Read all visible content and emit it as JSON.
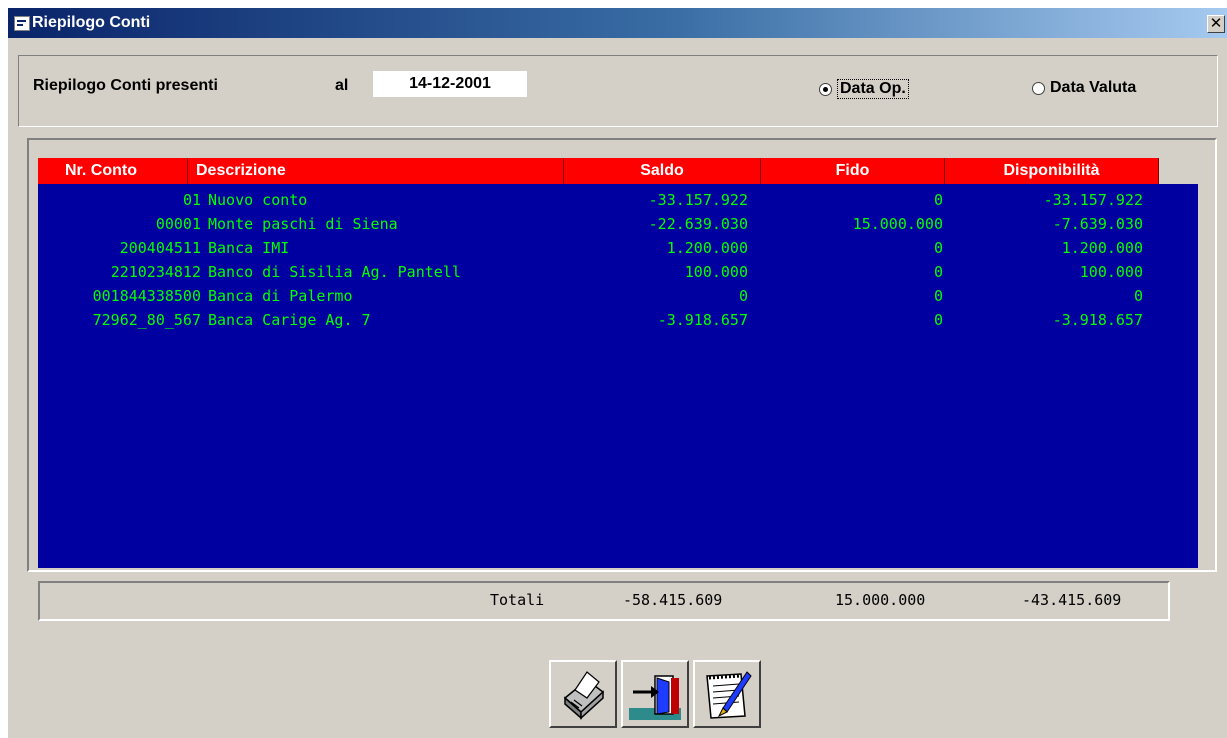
{
  "window": {
    "title": "Riepilogo Conti",
    "close_label": "✕"
  },
  "header": {
    "label": "Riepilogo Conti presenti",
    "al_label": "al",
    "date_value": "14-12-2001",
    "radio_data_op": "Data Op.",
    "radio_data_valuta": "Data Valuta",
    "selected_radio": "Data Op."
  },
  "grid": {
    "columns": [
      "Nr. Conto",
      "Descrizione",
      "Saldo",
      "Fido",
      "Disponibilità"
    ],
    "rows": [
      {
        "nr": "01",
        "desc": "Nuovo conto",
        "saldo": "-33.157.922",
        "fido": "0",
        "disp": "-33.157.922"
      },
      {
        "nr": "00001",
        "desc": "Monte paschi di Siena",
        "saldo": "-22.639.030",
        "fido": "15.000.000",
        "disp": "-7.639.030"
      },
      {
        "nr": "200404511",
        "desc": "Banca IMI",
        "saldo": "1.200.000",
        "fido": "0",
        "disp": "1.200.000"
      },
      {
        "nr": "2210234812",
        "desc": "Banco di Sisilia Ag. Pantell",
        "saldo": "100.000",
        "fido": "0",
        "disp": "100.000"
      },
      {
        "nr": "001844338500",
        "desc": "Banca di Palermo",
        "saldo": "0",
        "fido": "0",
        "disp": "0"
      },
      {
        "nr": "72962_80_567",
        "desc": "Banca Carige Ag. 7",
        "saldo": "-3.918.657",
        "fido": "0",
        "disp": "-3.918.657"
      }
    ],
    "colors": {
      "background": "#0000a0",
      "text": "#00ff00",
      "header_bg": "#ff0000",
      "header_text": "#ffffff"
    }
  },
  "totals": {
    "label": "Totali",
    "saldo": "-58.415.609",
    "fido": "15.000.000",
    "disp": "-43.415.609"
  },
  "toolbar": {
    "buttons": [
      {
        "icon": "printer-icon"
      },
      {
        "icon": "exit-door-icon"
      },
      {
        "icon": "notepad-pen-icon"
      }
    ]
  }
}
